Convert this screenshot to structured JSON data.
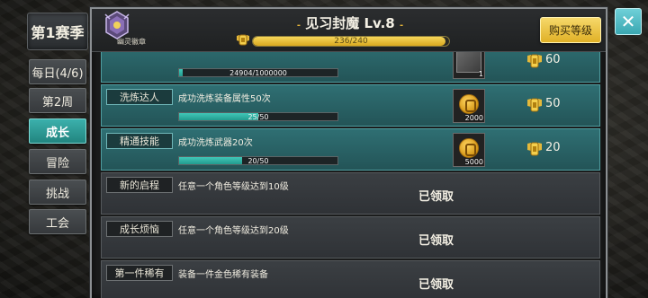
{
  "emblem": {
    "name": "幽灵徽章"
  },
  "header": {
    "title_decor": "-",
    "title": "见习封魔 Lv.8",
    "exp": {
      "current": 236,
      "max": 240,
      "text": "236/240"
    },
    "buy_label": "购买等级"
  },
  "sidebar": {
    "season": "第1赛季",
    "tabs": [
      {
        "label": "每日(4/6)",
        "active": false
      },
      {
        "label": "第2周",
        "active": false
      },
      {
        "label": "成长",
        "active": true
      },
      {
        "label": "冒险",
        "active": false
      },
      {
        "label": "挑战",
        "active": false
      },
      {
        "label": "工会",
        "active": false
      }
    ]
  },
  "rows": [
    {
      "tag": "",
      "desc": "",
      "progress_text": "24904/1000000",
      "progress": 0.025,
      "item": "stone",
      "item_count": "1",
      "reward": "60",
      "claimed": "",
      "style": "teal"
    },
    {
      "tag": "洗炼达人",
      "desc": "成功洗炼装备属性50次",
      "progress_text": "25/50",
      "progress": 0.5,
      "item": "coin",
      "item_count": "2000",
      "reward": "50",
      "claimed": "",
      "style": "teal"
    },
    {
      "tag": "精通技能",
      "desc": "成功洗炼武器20次",
      "progress_text": "20/50",
      "progress": 0.4,
      "item": "coin",
      "item_count": "5000",
      "reward": "20",
      "claimed": "",
      "style": "teal"
    },
    {
      "tag": "新的启程",
      "desc": "任意一个角色等级达到10级",
      "progress_text": "",
      "progress": null,
      "item": "",
      "item_count": "",
      "reward": "",
      "claimed": "已领取",
      "style": "gray"
    },
    {
      "tag": "成长烦恼",
      "desc": "任意一个角色等级达到20级",
      "progress_text": "",
      "progress": null,
      "item": "",
      "item_count": "",
      "reward": "",
      "claimed": "已领取",
      "style": "gray"
    },
    {
      "tag": "第一件稀有",
      "desc": "装备一件金色稀有装备",
      "progress_text": "",
      "progress": null,
      "item": "",
      "item_count": "",
      "reward": "",
      "claimed": "已领取",
      "style": "gray"
    }
  ],
  "close_label": "✕",
  "colors": {
    "accent_teal": "#2f9a95",
    "gold": "#e8b62a"
  }
}
